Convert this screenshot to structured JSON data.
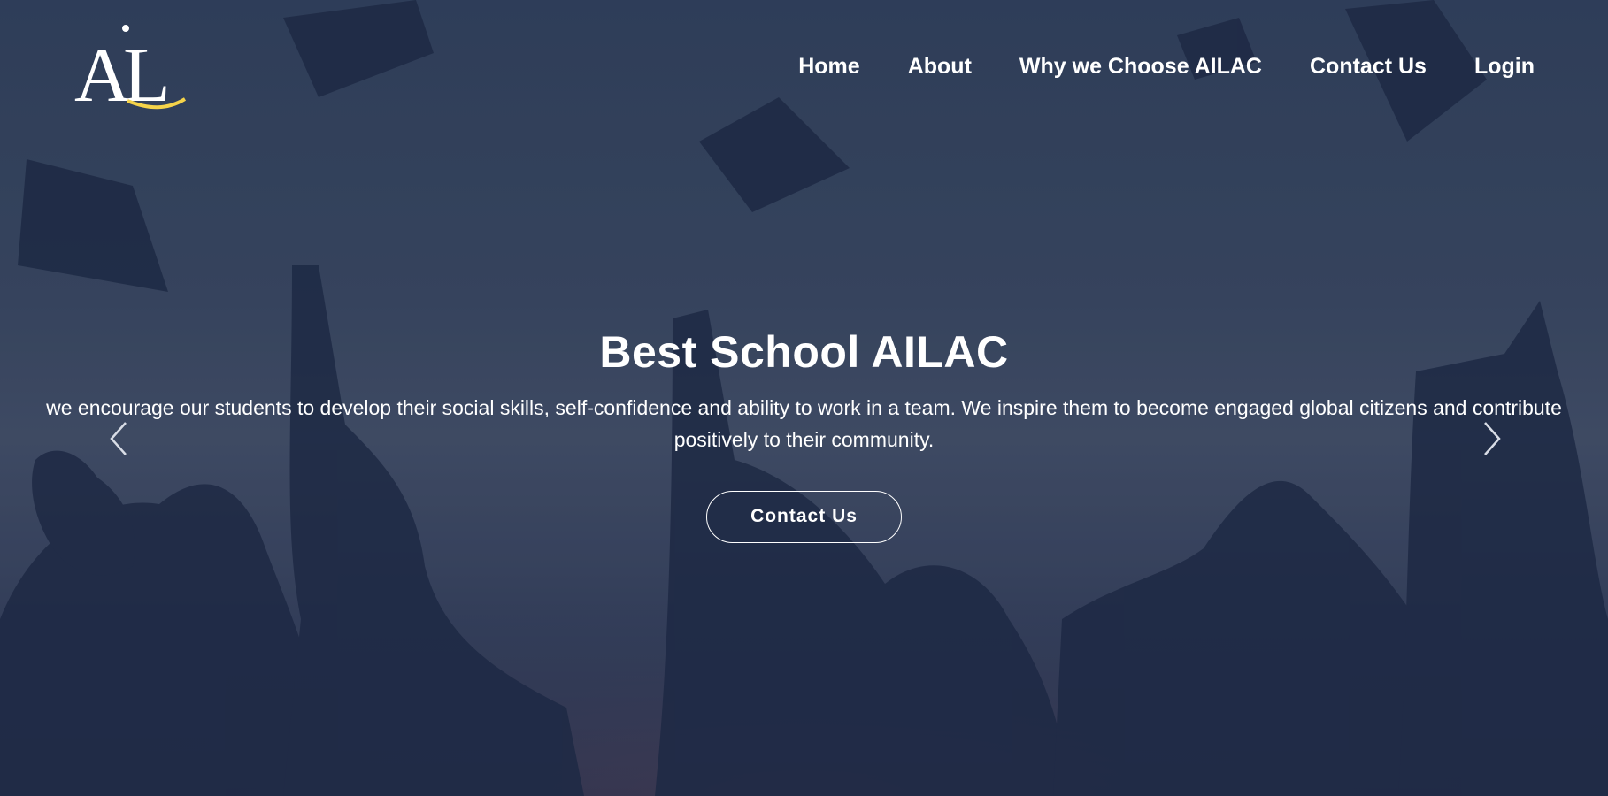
{
  "brand": {
    "logo_text_main": "AL",
    "logo_accent_color": "#f5d34a"
  },
  "nav": {
    "items": [
      "Home",
      "About",
      "Why we Choose AILAC",
      "Contact Us",
      "Login"
    ]
  },
  "hero": {
    "title": "Best School AILAC",
    "text": "we encourage our students to develop their social skills, self-confidence and ability to work in a team. We inspire them to become engaged global citizens and contribute positively to their community.",
    "cta_label": "Contact Us"
  },
  "carousel": {
    "prev_icon": "chevron-left-icon",
    "next_icon": "chevron-right-icon"
  },
  "colors": {
    "text": "#ffffff",
    "background": "#3a4862",
    "silhouette": "#1f2a45"
  }
}
